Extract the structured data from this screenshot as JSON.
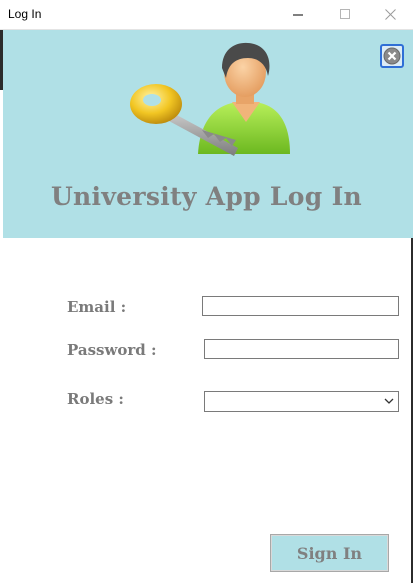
{
  "window": {
    "title": "Log In",
    "controls": {
      "minimize": "–",
      "maximize": "☐",
      "close": "✕"
    }
  },
  "banner": {
    "background": "#b0e0e6",
    "title": "University App Log In",
    "logo_icon": "user-key-icon",
    "close_icon": "close-circle-icon"
  },
  "form": {
    "email_label": "Email :",
    "email_value": "",
    "password_label": "Password :",
    "password_value": "",
    "roles_label": "Roles :",
    "roles_selected": ""
  },
  "actions": {
    "sign_in_label": "Sign In"
  }
}
